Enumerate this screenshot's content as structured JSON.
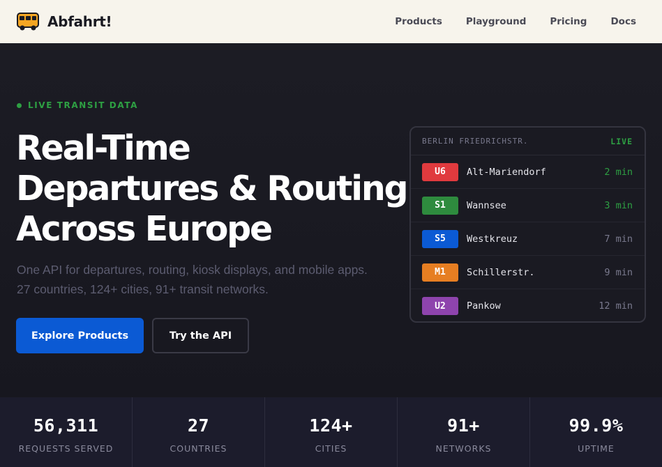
{
  "header": {
    "brand": "Abfahrt!",
    "brand_icon": "bus-icon",
    "nav": [
      {
        "label": "Products"
      },
      {
        "label": "Playground"
      },
      {
        "label": "Pricing"
      },
      {
        "label": "Docs"
      }
    ]
  },
  "hero": {
    "badge": "LIVE TRANSIT DATA",
    "headline": [
      "Real-Time",
      "Departures & Routing",
      "Across Europe"
    ],
    "subtitle": "One API for departures, routing, kiosk displays, and mobile apps. 27 countries, 124+ cities, 91+ transit networks.",
    "primary_cta": "Explore Products",
    "secondary_cta": "Try the API"
  },
  "board": {
    "station": "BERLIN FRIEDRICHSTR.",
    "status": "LIVE",
    "departures": [
      {
        "line": "U6",
        "color": "#e03a3e",
        "destination": "Alt-Mariendorf",
        "eta": "2 min"
      },
      {
        "line": "S1",
        "color": "#2e8b3e",
        "destination": "Wannsee",
        "eta": "3 min"
      },
      {
        "line": "S5",
        "color": "#0b5ad4",
        "destination": "Westkreuz",
        "eta": "7 min"
      },
      {
        "line": "M1",
        "color": "#e67e22",
        "destination": "Schillerstr.",
        "eta": "9 min"
      },
      {
        "line": "U2",
        "color": "#8e44ad",
        "destination": "Pankow",
        "eta": "12 min"
      }
    ]
  },
  "stats": [
    {
      "value": "56,311",
      "label": "REQUESTS SERVED"
    },
    {
      "value": "27",
      "label": "COUNTRIES"
    },
    {
      "value": "124+",
      "label": "CITIES"
    },
    {
      "value": "91+",
      "label": "NETWORKS"
    },
    {
      "value": "99.9%",
      "label": "UPTIME"
    }
  ],
  "colors": {
    "accent_blue": "#0b5ad4",
    "live_green": "#2ea043",
    "header_bg": "#f7f4ec",
    "hero_bg": "#1c1c24"
  }
}
